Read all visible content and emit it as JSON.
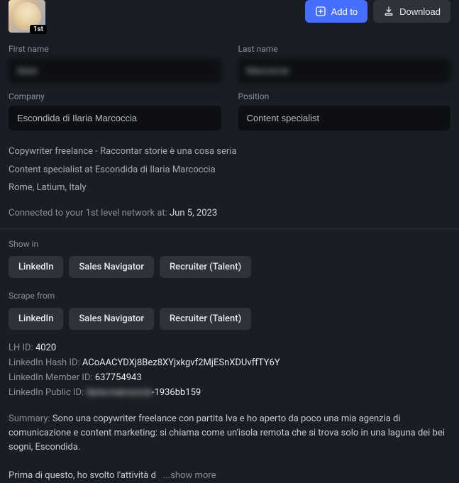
{
  "header": {
    "badge": "1st",
    "add_to_label": "Add to",
    "download_label": "Download"
  },
  "fields": {
    "first_name": {
      "label": "First name",
      "value": "Ilaria"
    },
    "last_name": {
      "label": "Last name",
      "value": "Marcoccia"
    },
    "company": {
      "label": "Company",
      "value": "Escondida di Ilaria Marcoccia"
    },
    "position": {
      "label": "Position",
      "value": "Content specialist"
    }
  },
  "info": {
    "tagline": "Copywriter freelance - Raccontar storie è una cosa seria",
    "role": "Content specialist at Escondida di Ilaria Marcoccia",
    "location": "Rome, Latium, Italy"
  },
  "connected": {
    "label": "Connected to your 1st level network at: ",
    "date": "Jun 5, 2023"
  },
  "show_in": {
    "label": "Show in",
    "options": [
      "LinkedIn",
      "Sales Navigator",
      "Recruiter (Talent)"
    ]
  },
  "scrape_from": {
    "label": "Scrape from",
    "options": [
      "LinkedIn",
      "Sales Navigator",
      "Recruiter (Talent)"
    ]
  },
  "ids": {
    "lh_id": {
      "label": "LH ID: ",
      "value": "4020"
    },
    "hash_id": {
      "label": "LinkedIn Hash ID: ",
      "value": "ACoAACYDXj8Bez8XYjxkgvf2MjESnXDUvffTY6Y"
    },
    "member_id": {
      "label": "LinkedIn Member ID: ",
      "value": "637754943"
    },
    "public_id": {
      "label": "LinkedIn Public ID: ",
      "value_redacted": "ilaria-marcoccia",
      "value_suffix": "-1936bb159"
    }
  },
  "summary": {
    "label": "Summary: ",
    "text": "Sono una copywriter freelance con partita Iva e ho aperto da poco una mia agenzia di comunicazione e content marketing: si chiama come un'isola remota che si trova solo in una laguna dei bei sogni, Escondida.",
    "text2": "Prima di questo, ho svolto l'attività d",
    "show_more": "...show more"
  }
}
